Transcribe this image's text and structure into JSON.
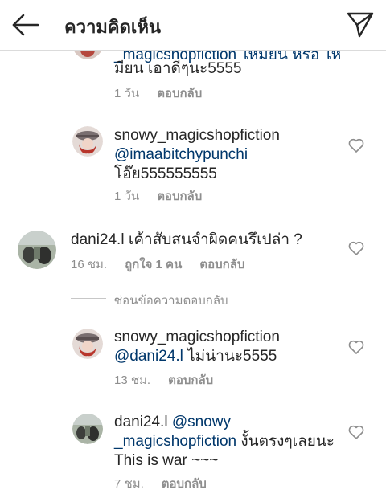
{
  "header": {
    "title": "ความคิดเห็น",
    "back_icon": "arrow-left-icon",
    "send_icon": "paper-plane-icon"
  },
  "comments": [
    {
      "line1": "_magicshopfiction ให้มียน หรือ ให้",
      "line2": "มียน เอาดีๆนะ5555",
      "time": "1 วัน",
      "reply": "ตอบกลับ"
    },
    {
      "username": "snowy_magicshopfiction",
      "mention": "@imaabitchypunchi",
      "text": "โอ๊ย555555555",
      "time": "1 วัน",
      "reply": "ตอบกลับ"
    },
    {
      "username": "dani24.l",
      "text": "เค้าสับสนจำผิดคนรึเปล่า ?",
      "time": "16 ชม.",
      "likes": "ถูกใจ 1 คน",
      "reply": "ตอบกลับ"
    },
    {
      "username": "snowy_magicshopfiction",
      "mention": "@dani24.l",
      "text": "ไม่น่านะ5555",
      "time": "13 ชม.",
      "reply": "ตอบกลับ"
    },
    {
      "username": "dani24.l",
      "mention_line1": "@snowy",
      "mention_line2": "_magicshopfiction",
      "text_line2": "งั้นตรงๆเลยนะ",
      "text_line3": "This is war ~~~",
      "time": "7 ชม.",
      "reply": "ตอบกลับ"
    }
  ],
  "hide_replies": "ซ่อนข้อความตอบกลับ",
  "colors": {
    "text": "#262626",
    "secondary": "#8e8e8e",
    "mention": "#00376b",
    "divider": "#dbdbdb"
  }
}
